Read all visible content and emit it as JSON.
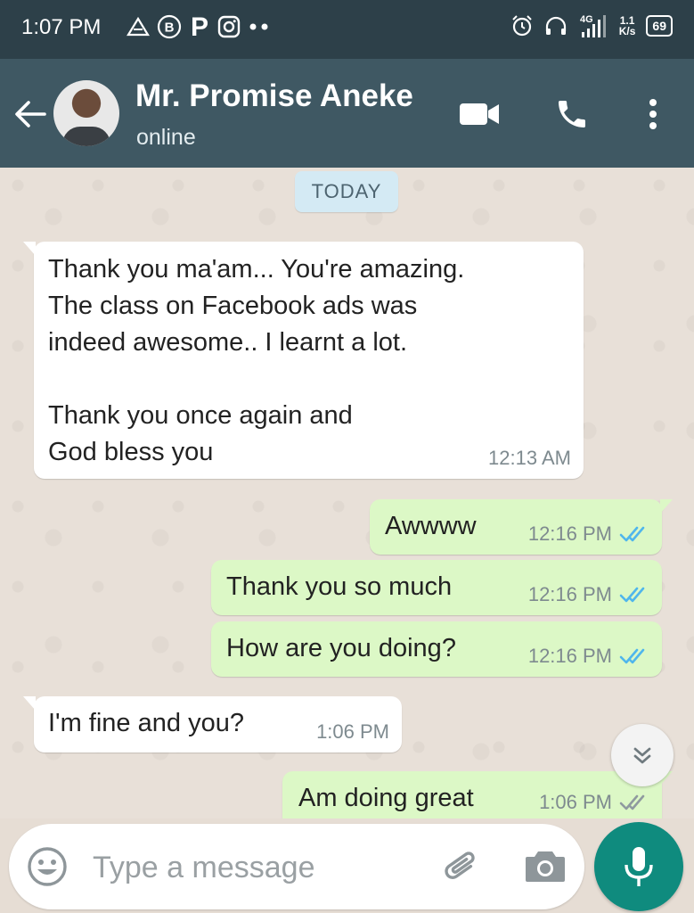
{
  "status_bar": {
    "time": "1:07 PM",
    "left_icons": [
      "triangle-alert-icon",
      "bitcoin-circle-icon",
      "p-app-icon",
      "instagram-icon",
      "more-dots-icon"
    ],
    "right_icons": [
      "alarm-icon",
      "headphones-icon",
      "signal-4g-icon"
    ],
    "network_type": "4G",
    "speed_value": "1.1",
    "speed_unit": "K/s",
    "battery": "69"
  },
  "header": {
    "contact_name": "Mr. Promise Aneke",
    "contact_status": "online",
    "icons": [
      "back-arrow-icon",
      "video-call-icon",
      "phone-icon",
      "more-vert-icon"
    ]
  },
  "chat": {
    "date_chip": "TODAY",
    "messages": [
      {
        "direction": "in",
        "text": "Thank you ma'am... You're amazing.\nThe class on Facebook ads was\nindeed awesome.. I learnt a lot.\n\nThank you once again and\nGod bless you",
        "time": "12:13 AM"
      },
      {
        "direction": "out",
        "text": "Awwww",
        "time": "12:16 PM",
        "status": "read"
      },
      {
        "direction": "out",
        "text": "Thank you so much",
        "time": "12:16 PM",
        "status": "read"
      },
      {
        "direction": "out",
        "text": "How are you doing?",
        "time": "12:16 PM",
        "status": "read"
      },
      {
        "direction": "in",
        "text": "I'm fine and you?",
        "time": "1:06 PM"
      },
      {
        "direction": "out",
        "text": "Am doing great",
        "time": "1:06 PM",
        "status": "delivered"
      }
    ],
    "scroll_button_icon": "chevrons-down-icon"
  },
  "input_bar": {
    "placeholder": "Type a message",
    "icons": [
      "emoji-icon",
      "paperclip-icon",
      "camera-icon",
      "mic-icon"
    ]
  },
  "colors": {
    "status_bar_bg": "#2d4049",
    "header_bg": "#3f5863",
    "chat_bg": "#e8e0d8",
    "incoming_bubble": "#ffffff",
    "outgoing_bubble": "#dcf8c6",
    "read_ticks": "#4fb6ec",
    "delivered_ticks": "#8f9a9f",
    "mic_button": "#0f8b7e"
  }
}
